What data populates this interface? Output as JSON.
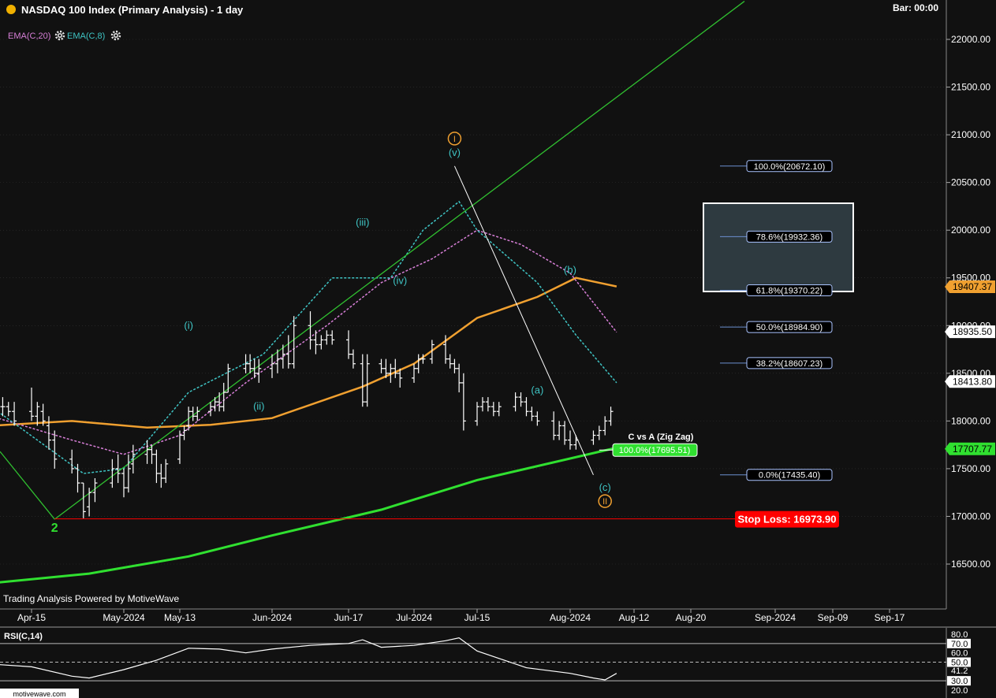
{
  "header": {
    "title": "NASDAQ 100 Index (Primary Analysis) - 1 day",
    "bar_label": "Bar: 00:00",
    "ema20_label": "EMA(C,20)",
    "ema8_label": "EMA(C,8)",
    "gear_icon": "gear-icon",
    "status_dot_color": "#f0b000"
  },
  "footer": {
    "credit": "Trading Analysis Powered by MotiveWave",
    "watermark": "motivewave.com"
  },
  "colors": {
    "bars": "#ffffff",
    "ema8": "#3fc4c4",
    "ema20": "#d77fd7",
    "ma_orange": "#f0a030",
    "ma_green": "#30e030",
    "trendline": "#30c030",
    "wave_cyan": "#3fc4c4",
    "wave_orange": "#f0a030",
    "wave_green": "#30e030",
    "stop_red": "#ff0000",
    "fib_line": "#6b8fd0",
    "grid": "#333333"
  },
  "chart_data": {
    "type": "ohlc",
    "y_axis": {
      "ylim": [
        16150,
        22400
      ],
      "ticks": [
        "22000.00",
        "21500.00",
        "21000.00",
        "20500.00",
        "20000.00",
        "19500.00",
        "19000.00",
        "18500.00",
        "18000.00",
        "17500.00",
        "17000.00",
        "16500.00"
      ],
      "tick_values": [
        22000,
        21500,
        21000,
        20500,
        20000,
        19500,
        19000,
        18500,
        18000,
        17500,
        17000,
        16500
      ]
    },
    "x_axis": {
      "labels": [
        "Apr-15",
        "May-2024",
        "May-13",
        "Jun-2024",
        "Jun-17",
        "Jul-2024",
        "Jul-15",
        "Aug-2024",
        "Aug-12",
        "Aug-20",
        "Sep-2024",
        "Sep-09",
        "Sep-17"
      ],
      "dates": [
        "2024-04-15",
        "2024-05-01",
        "2024-05-13",
        "2024-06-03",
        "2024-06-17",
        "2024-07-01",
        "2024-07-15",
        "2024-08-01",
        "2024-08-12",
        "2024-08-20",
        "2024-09-03",
        "2024-09-09",
        "2024-09-17"
      ]
    },
    "price_tags": [
      {
        "label": "19407.37",
        "value": 19407.37,
        "color": "#f0a030",
        "text_color": "#000000"
      },
      {
        "label": "18935.50",
        "value": 18935.5,
        "color": "#ffffff",
        "text_color": "#000000"
      },
      {
        "label": "18413.80",
        "value": 18413.8,
        "color": "#ffffff",
        "text_color": "#000000"
      },
      {
        "label": "17707.77",
        "value": 17707.77,
        "color": "#30e030",
        "text_color": "#000000"
      }
    ],
    "fib_levels": [
      {
        "label": "100.0%(20672.10)",
        "value": 20672.1
      },
      {
        "label": "78.6%(19932.36)",
        "value": 19932.36
      },
      {
        "label": "61.8%(19370.22)",
        "value": 19370.22
      },
      {
        "label": "50.0%(18984.90)",
        "value": 18984.9
      },
      {
        "label": "38.2%(18607.23)",
        "value": 18607.23
      },
      {
        "label": "0.0%(17435.40)",
        "value": 17435.4
      }
    ],
    "zigzag": {
      "title": "C vs A (Zig Zag)",
      "label": "100.0%(17695.51)",
      "value": 17695.51
    },
    "stop_loss": {
      "label": "Stop Loss: 16973.90",
      "value": 16973.9
    },
    "wave_labels": [
      {
        "text": "2",
        "date": "2024-04-19",
        "value": 16880,
        "style": "green"
      },
      {
        "text": "(i)",
        "date": "2024-05-15",
        "value": 19000,
        "style": "cyan"
      },
      {
        "text": "(ii)",
        "date": "2024-05-31",
        "value": 18150,
        "style": "cyan"
      },
      {
        "text": "(iii)",
        "date": "2024-06-20",
        "value": 20080,
        "style": "cyan"
      },
      {
        "text": "(iv)",
        "date": "2024-06-28",
        "value": 19470,
        "style": "cyan"
      },
      {
        "text": "(v)",
        "date": "2024-07-10",
        "value": 20810,
        "style": "cyan"
      },
      {
        "text": "I",
        "date": "2024-07-10",
        "value": 20960,
        "style": "orange-circle"
      },
      {
        "text": "(a)",
        "date": "2024-07-26",
        "value": 18320,
        "style": "cyan"
      },
      {
        "text": "(b)",
        "date": "2024-08-01",
        "value": 19580,
        "style": "cyan"
      },
      {
        "text": "(c)",
        "date": "2024-08-07",
        "value": 17300,
        "style": "cyan"
      },
      {
        "text": "II",
        "date": "2024-08-07",
        "value": 17160,
        "style": "orange-circle"
      }
    ],
    "bars": [
      {
        "date": "2024-04-10",
        "o": 18150,
        "h": 18250,
        "l": 18050,
        "c": 18150
      },
      {
        "date": "2024-04-11",
        "o": 18150,
        "h": 18200,
        "l": 18050,
        "c": 18100
      },
      {
        "date": "2024-04-12",
        "o": 18100,
        "h": 18200,
        "l": 17950,
        "c": 18000
      },
      {
        "date": "2024-04-15",
        "o": 18100,
        "h": 18350,
        "l": 18000,
        "c": 18050
      },
      {
        "date": "2024-04-16",
        "o": 18050,
        "h": 18200,
        "l": 17950,
        "c": 18150
      },
      {
        "date": "2024-04-17",
        "o": 18100,
        "h": 18180,
        "l": 17950,
        "c": 18000
      },
      {
        "date": "2024-04-18",
        "o": 17950,
        "h": 18050,
        "l": 17700,
        "c": 17800
      },
      {
        "date": "2024-04-19",
        "o": 17800,
        "h": 17900,
        "l": 17500,
        "c": 17600
      },
      {
        "date": "2024-04-22",
        "o": 17600,
        "h": 17700,
        "l": 17450,
        "c": 17500
      },
      {
        "date": "2024-04-23",
        "o": 17500,
        "h": 17550,
        "l": 17250,
        "c": 17350
      },
      {
        "date": "2024-04-24",
        "o": 17350,
        "h": 17350,
        "l": 16980,
        "c": 17050
      },
      {
        "date": "2024-04-25",
        "o": 17100,
        "h": 17300,
        "l": 17000,
        "c": 17250
      },
      {
        "date": "2024-04-26",
        "o": 17250,
        "h": 17400,
        "l": 17150,
        "c": 17350
      },
      {
        "date": "2024-04-29",
        "o": 17350,
        "h": 17600,
        "l": 17300,
        "c": 17500
      },
      {
        "date": "2024-04-30",
        "o": 17500,
        "h": 17650,
        "l": 17350,
        "c": 17450
      },
      {
        "date": "2024-05-01",
        "o": 17450,
        "h": 17500,
        "l": 17200,
        "c": 17300
      },
      {
        "date": "2024-05-02",
        "o": 17300,
        "h": 17650,
        "l": 17250,
        "c": 17500
      },
      {
        "date": "2024-05-03",
        "o": 17550,
        "h": 17750,
        "l": 17450,
        "c": 17650
      },
      {
        "date": "2024-05-06",
        "o": 17650,
        "h": 17800,
        "l": 17550,
        "c": 17700
      },
      {
        "date": "2024-05-07",
        "o": 17700,
        "h": 17750,
        "l": 17550,
        "c": 17650
      },
      {
        "date": "2024-05-08",
        "o": 17650,
        "h": 17700,
        "l": 17350,
        "c": 17450
      },
      {
        "date": "2024-05-09",
        "o": 17450,
        "h": 17550,
        "l": 17300,
        "c": 17400
      },
      {
        "date": "2024-05-10",
        "o": 17400,
        "h": 17600,
        "l": 17350,
        "c": 17550
      },
      {
        "date": "2024-05-13",
        "o": 17600,
        "h": 17900,
        "l": 17550,
        "c": 17850
      },
      {
        "date": "2024-05-14",
        "o": 17850,
        "h": 17950,
        "l": 17800,
        "c": 17900
      },
      {
        "date": "2024-05-15",
        "o": 17950,
        "h": 18150,
        "l": 17900,
        "c": 18100
      },
      {
        "date": "2024-05-16",
        "o": 18100,
        "h": 18150,
        "l": 18000,
        "c": 18050
      },
      {
        "date": "2024-05-17",
        "o": 18050,
        "h": 18150,
        "l": 18000,
        "c": 18100
      },
      {
        "date": "2024-05-20",
        "o": 18100,
        "h": 18200,
        "l": 18050,
        "c": 18150
      },
      {
        "date": "2024-05-21",
        "o": 18150,
        "h": 18250,
        "l": 18100,
        "c": 18200
      },
      {
        "date": "2024-05-22",
        "o": 18200,
        "h": 18300,
        "l": 18100,
        "c": 18150
      },
      {
        "date": "2024-05-23",
        "o": 18150,
        "h": 18400,
        "l": 18100,
        "c": 18300
      },
      {
        "date": "2024-05-24",
        "o": 18300,
        "h": 18600,
        "l": 18300,
        "c": 18550
      },
      {
        "date": "2024-05-28",
        "o": 18550,
        "h": 18700,
        "l": 18500,
        "c": 18600
      },
      {
        "date": "2024-05-29",
        "o": 18600,
        "h": 18700,
        "l": 18500,
        "c": 18550
      },
      {
        "date": "2024-05-30",
        "o": 18550,
        "h": 18650,
        "l": 18450,
        "c": 18500
      },
      {
        "date": "2024-05-31",
        "o": 18500,
        "h": 18650,
        "l": 18400,
        "c": 18550
      },
      {
        "date": "2024-06-03",
        "o": 18550,
        "h": 18700,
        "l": 18450,
        "c": 18600
      },
      {
        "date": "2024-06-04",
        "o": 18600,
        "h": 18750,
        "l": 18500,
        "c": 18650
      },
      {
        "date": "2024-06-05",
        "o": 18650,
        "h": 18800,
        "l": 18550,
        "c": 18700
      },
      {
        "date": "2024-06-06",
        "o": 18700,
        "h": 18900,
        "l": 18550,
        "c": 18600
      },
      {
        "date": "2024-06-07",
        "o": 18600,
        "h": 19100,
        "l": 18550,
        "c": 19000
      },
      {
        "date": "2024-06-10",
        "o": 19000,
        "h": 19150,
        "l": 18750,
        "c": 18850
      },
      {
        "date": "2024-06-11",
        "o": 18850,
        "h": 18950,
        "l": 18700,
        "c": 18800
      },
      {
        "date": "2024-06-12",
        "o": 18800,
        "h": 18900,
        "l": 18750,
        "c": 18850
      },
      {
        "date": "2024-06-13",
        "o": 18850,
        "h": 18950,
        "l": 18800,
        "c": 18900
      },
      {
        "date": "2024-06-14",
        "o": 18900,
        "h": 18950,
        "l": 18800,
        "c": 18850
      },
      {
        "date": "2024-06-17",
        "o": 18850,
        "h": 18950,
        "l": 18650,
        "c": 18700
      },
      {
        "date": "2024-06-18",
        "o": 18700,
        "h": 18750,
        "l": 18550,
        "c": 18600
      },
      {
        "date": "2024-06-20",
        "o": 18600,
        "h": 18700,
        "l": 18150,
        "c": 18200
      },
      {
        "date": "2024-06-21",
        "o": 18200,
        "h": 18700,
        "l": 18150,
        "c": 18600
      },
      {
        "date": "2024-06-24",
        "o": 18600,
        "h": 18650,
        "l": 18500,
        "c": 18550
      },
      {
        "date": "2024-06-25",
        "o": 18550,
        "h": 18650,
        "l": 18450,
        "c": 18500
      },
      {
        "date": "2024-06-26",
        "o": 18500,
        "h": 18600,
        "l": 18400,
        "c": 18550
      },
      {
        "date": "2024-06-27",
        "o": 18550,
        "h": 18650,
        "l": 18450,
        "c": 18500
      },
      {
        "date": "2024-06-28",
        "o": 18500,
        "h": 18550,
        "l": 18350,
        "c": 18450
      },
      {
        "date": "2024-07-01",
        "o": 18450,
        "h": 18600,
        "l": 18400,
        "c": 18550
      },
      {
        "date": "2024-07-02",
        "o": 18550,
        "h": 18700,
        "l": 18500,
        "c": 18650
      },
      {
        "date": "2024-07-03",
        "o": 18650,
        "h": 18700,
        "l": 18600,
        "c": 18650
      },
      {
        "date": "2024-07-05",
        "o": 18650,
        "h": 18850,
        "l": 18600,
        "c": 18800
      },
      {
        "date": "2024-07-08",
        "o": 18800,
        "h": 18900,
        "l": 18600,
        "c": 18650
      },
      {
        "date": "2024-07-09",
        "o": 18650,
        "h": 18700,
        "l": 18550,
        "c": 18600
      },
      {
        "date": "2024-07-10",
        "o": 18600,
        "h": 18650,
        "l": 18500,
        "c": 18550
      },
      {
        "date": "2024-07-11",
        "o": 18550,
        "h": 18600,
        "l": 18300,
        "c": 18400
      },
      {
        "date": "2024-07-12",
        "o": 18400,
        "h": 18500,
        "l": 17900,
        "c": 18000
      },
      {
        "date": "2024-07-15",
        "o": 18000,
        "h": 18200,
        "l": 17950,
        "c": 18150
      },
      {
        "date": "2024-07-16",
        "o": 18150,
        "h": 18250,
        "l": 18100,
        "c": 18200
      },
      {
        "date": "2024-07-17",
        "o": 18200,
        "h": 18250,
        "l": 18100,
        "c": 18150
      },
      {
        "date": "2024-07-18",
        "o": 18150,
        "h": 18200,
        "l": 18050,
        "c": 18100
      },
      {
        "date": "2024-07-19",
        "o": 18100,
        "h": 18200,
        "l": 18050,
        "c": 18150
      },
      {
        "date": "2024-07-22",
        "o": 18150,
        "h": 18300,
        "l": 18100,
        "c": 18250
      },
      {
        "date": "2024-07-23",
        "o": 18250,
        "h": 18300,
        "l": 18150,
        "c": 18200
      },
      {
        "date": "2024-07-24",
        "o": 18200,
        "h": 18250,
        "l": 18050,
        "c": 18100
      },
      {
        "date": "2024-07-25",
        "o": 18100,
        "h": 18150,
        "l": 18000,
        "c": 18050
      },
      {
        "date": "2024-07-26",
        "o": 18050,
        "h": 18100,
        "l": 17950,
        "c": 18000
      },
      {
        "date": "2024-07-29",
        "o": 18000,
        "h": 18100,
        "l": 17800,
        "c": 17850
      },
      {
        "date": "2024-07-30",
        "o": 17850,
        "h": 18000,
        "l": 17800,
        "c": 17950
      },
      {
        "date": "2024-07-31",
        "o": 17950,
        "h": 18000,
        "l": 17750,
        "c": 17800
      },
      {
        "date": "2024-08-01",
        "o": 17800,
        "h": 17900,
        "l": 17700,
        "c": 17750
      },
      {
        "date": "2024-08-02",
        "o": 17750,
        "h": 17850,
        "l": 17700,
        "c": 17800
      },
      {
        "date": "2024-08-05",
        "o": 17800,
        "h": 17900,
        "l": 17750,
        "c": 17850
      },
      {
        "date": "2024-08-06",
        "o": 17850,
        "h": 17950,
        "l": 17800,
        "c": 17900
      },
      {
        "date": "2024-08-07",
        "o": 17900,
        "h": 18050,
        "l": 17850,
        "c": 18000
      },
      {
        "date": "2024-08-08",
        "o": 18000,
        "h": 18150,
        "l": 17950,
        "c": 18100
      }
    ],
    "rsi": {
      "label": "RSI(C,14)",
      "ylim": [
        20,
        80
      ],
      "ticks": [
        "80.0",
        "70.0",
        "60.0",
        "50.0",
        "41.2",
        "30.0",
        "20.0"
      ],
      "tick_values": [
        80,
        70,
        60,
        50,
        41.2,
        30,
        20
      ],
      "levels": [
        70,
        50,
        30
      ],
      "current": "41.2"
    }
  }
}
